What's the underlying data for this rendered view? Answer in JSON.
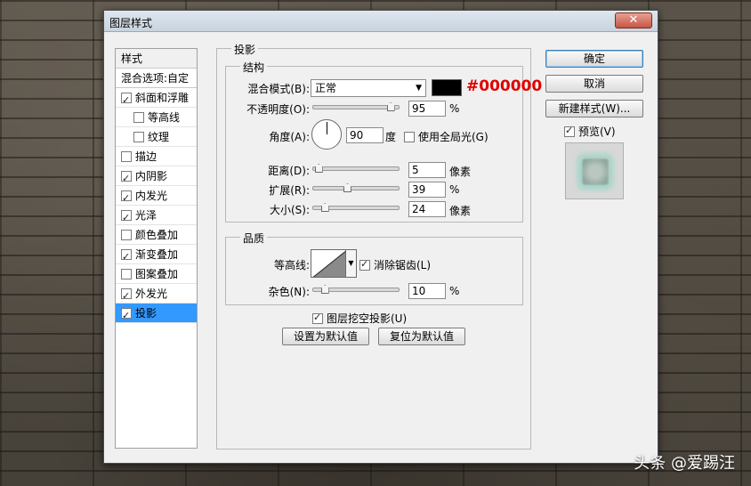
{
  "dialog": {
    "title": "图层样式",
    "close_symbol": "✕"
  },
  "style_list": {
    "header": "样式",
    "blend_options": "混合选项:自定",
    "items": [
      {
        "label": "斜面和浮雕",
        "checked": true,
        "sub": false,
        "selected": false
      },
      {
        "label": "等高线",
        "checked": false,
        "sub": true,
        "selected": false
      },
      {
        "label": "纹理",
        "checked": false,
        "sub": true,
        "selected": false
      },
      {
        "label": "描边",
        "checked": false,
        "sub": false,
        "selected": false
      },
      {
        "label": "内阴影",
        "checked": true,
        "sub": false,
        "selected": false
      },
      {
        "label": "内发光",
        "checked": true,
        "sub": false,
        "selected": false
      },
      {
        "label": "光泽",
        "checked": true,
        "sub": false,
        "selected": false
      },
      {
        "label": "颜色叠加",
        "checked": false,
        "sub": false,
        "selected": false
      },
      {
        "label": "渐变叠加",
        "checked": true,
        "sub": false,
        "selected": false
      },
      {
        "label": "图案叠加",
        "checked": false,
        "sub": false,
        "selected": false
      },
      {
        "label": "外发光",
        "checked": true,
        "sub": false,
        "selected": false
      },
      {
        "label": "投影",
        "checked": true,
        "sub": false,
        "selected": true
      }
    ]
  },
  "drop_shadow": {
    "section_title": "投影",
    "structure": {
      "title": "结构",
      "blend_mode_label": "混合模式(B):",
      "blend_mode_value": "正常",
      "color_hex": "#000000",
      "color_annotation": "#000000",
      "opacity_label": "不透明度(O):",
      "opacity_value": "95",
      "opacity_unit": "%",
      "opacity_fraction": 0.95,
      "angle_label": "角度(A):",
      "angle_value": "90",
      "angle_unit": "度",
      "global_light_label": "使用全局光(G)",
      "global_light_checked": false,
      "distance_label": "距离(D):",
      "distance_value": "5",
      "distance_unit": "像素",
      "distance_fraction": 0.02,
      "spread_label": "扩展(R):",
      "spread_value": "39",
      "spread_unit": "%",
      "spread_fraction": 0.39,
      "size_label": "大小(S):",
      "size_value": "24",
      "size_unit": "像素",
      "size_fraction": 0.1
    },
    "quality": {
      "title": "品质",
      "contour_label": "等高线:",
      "anti_alias_label": "消除锯齿(L)",
      "anti_alias_checked": true,
      "noise_label": "杂色(N):",
      "noise_value": "10",
      "noise_unit": "%",
      "noise_fraction": 0.1
    },
    "knockout_label": "图层挖空投影(U)",
    "knockout_checked": true,
    "make_default_button": "设置为默认值",
    "reset_default_button": "复位为默认值"
  },
  "buttons": {
    "ok": "确定",
    "cancel": "取消",
    "new_style": "新建样式(W)...",
    "preview_label": "预览(V)",
    "preview_checked": true
  },
  "watermark": "头条 @爱踢汪"
}
